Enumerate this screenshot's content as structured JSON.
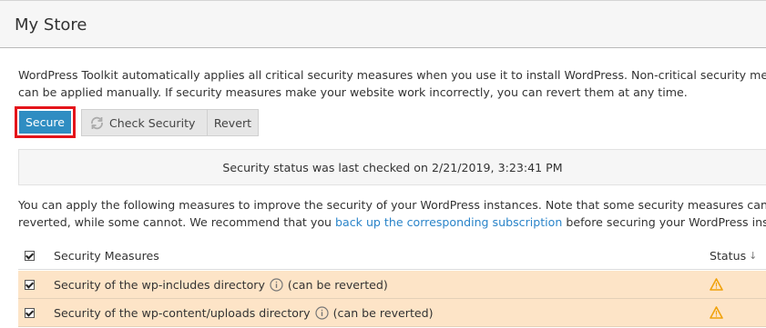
{
  "page": {
    "title": "My Store"
  },
  "intro": {
    "line1": "WordPress Toolkit automatically applies all critical security measures when you use it to install WordPress. Non-critical security measures",
    "line2": "can be applied manually. If security measures make your website work incorrectly, you can revert them at any time."
  },
  "toolbar": {
    "secure_label": "Secure",
    "check_label": "Check Security",
    "revert_label": "Revert"
  },
  "status": {
    "text": "Security status was last checked on 2/21/2019, 3:23:41 PM"
  },
  "note": {
    "line1": "You can apply the following measures to improve the security of your WordPress instances. Note that some security measures can be",
    "line2_pre": "reverted, while some cannot. We recommend that you ",
    "link": "back up the corresponding subscription",
    "line2_post": " before securing your WordPress instances."
  },
  "table": {
    "col_measures": "Security Measures",
    "col_status": "Status",
    "sort_indicator": "↓",
    "rows": [
      {
        "label": "Security of the wp-includes directory",
        "suffix": "(can be reverted)",
        "checked": true,
        "status": "warning"
      },
      {
        "label": "Security of the wp-content/uploads directory",
        "suffix": "(can be reverted)",
        "checked": true,
        "status": "warning"
      }
    ]
  },
  "colors": {
    "secure_button": "#2f8dc2",
    "highlight_border": "#e4141a",
    "warning_row": "#fde4c7",
    "warning_icon": "#f0a20c",
    "link": "#2a84c9"
  },
  "icons": {
    "check": "refresh-icon",
    "info": "info-icon",
    "status": "warning-icon"
  }
}
